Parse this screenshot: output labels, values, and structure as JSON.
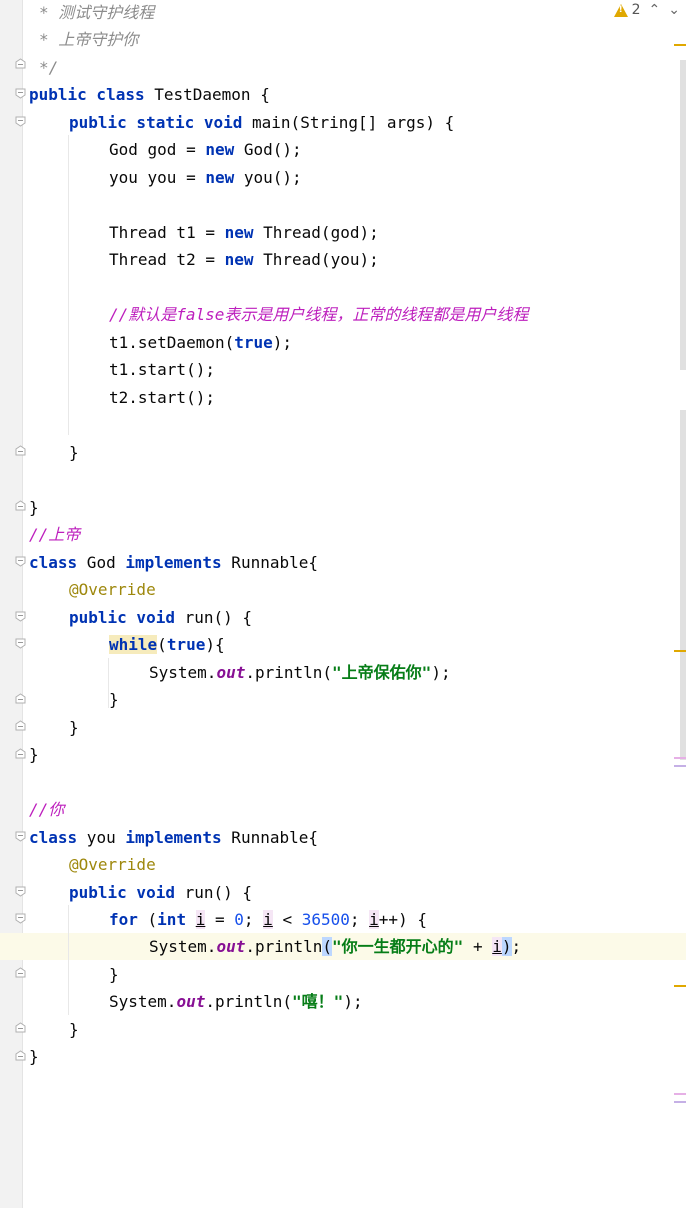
{
  "editor": {
    "warning_count": "2",
    "colors": {
      "keyword": "#0033b3",
      "string": "#067d17",
      "comment": "#8c8c8c",
      "line_comment": "#bd1fbd",
      "annotation": "#9e880d",
      "number": "#1750eb",
      "field": "#871094",
      "warning": "#e0a800"
    },
    "icons": [
      "warning-icon",
      "nav-up-icon",
      "nav-down-icon",
      "fold-icon"
    ],
    "code": {
      "l1": "* 测试守护线程",
      "l2": "* 上帝守护你",
      "l3": "*/",
      "l4_kw": "public class",
      "l4_rest": " TestDaemon {",
      "l5_kw": "public static void",
      "l5_rest": " main(String[] args) {",
      "l6_a": "God god = ",
      "l6_kw": "new",
      "l6_b": " God();",
      "l7_a": "you you = ",
      "l7_kw": "new",
      "l7_b": " you();",
      "l8_a": "Thread t1 = ",
      "l8_kw": "new",
      "l8_b": " Thread(god);",
      "l9_a": "Thread t2 = ",
      "l9_kw": "new",
      "l9_b": " Thread(you);",
      "l10": "//默认是false表示是用户线程，正常的线程都是用户线程",
      "l11_a": "t1.setDaemon(",
      "l11_kw": "true",
      "l11_b": ");",
      "l12": "t1.start();",
      "l13": "t2.start();",
      "l14": "}",
      "l15": "}",
      "l16": "//上帝",
      "l17_kw": "class",
      "l17_a": " God ",
      "l17_kw2": "implements",
      "l17_b": " Runnable{",
      "l18": "@Override",
      "l19_kw": "public void",
      "l19_rest": " run() {",
      "l20_kw": "while",
      "l20_a": "(",
      "l20_kw2": "true",
      "l20_b": "){",
      "l21_a": "System.",
      "l21_fld": "out",
      "l21_b": ".println(",
      "l21_str": "\"上帝保佑你\"",
      "l21_c": ");",
      "l22": "}",
      "l23": "}",
      "l24": "}",
      "l25": "//你",
      "l26_kw": "class",
      "l26_a": " you ",
      "l26_kw2": "implements",
      "l26_b": " Runnable{",
      "l27": "@Override",
      "l28_kw": "public void",
      "l28_rest": " run() {",
      "l29_kw": "for",
      "l29_a": " (",
      "l29_kw2": "int",
      "l29_sp": " ",
      "l29_i1": "i",
      "l29_b": " = ",
      "l29_n0": "0",
      "l29_c": "; ",
      "l29_i2": "i",
      "l29_d": " < ",
      "l29_n1": "36500",
      "l29_e": "; ",
      "l29_i3": "i",
      "l29_f": "++) {",
      "l30_a": "System.",
      "l30_fld": "out",
      "l30_b": ".println",
      "l30_p1": "(",
      "l30_str": "\"你一生都开心的\"",
      "l30_c": " + ",
      "l30_i": "i",
      "l30_p2": ")",
      "l30_d": ";",
      "l31": "}",
      "l32_a": "System.",
      "l32_fld": "out",
      "l32_b": ".println(",
      "l32_str": "\"嘻！\"",
      "l32_c": ");",
      "l33": "}",
      "l34": "}"
    }
  }
}
